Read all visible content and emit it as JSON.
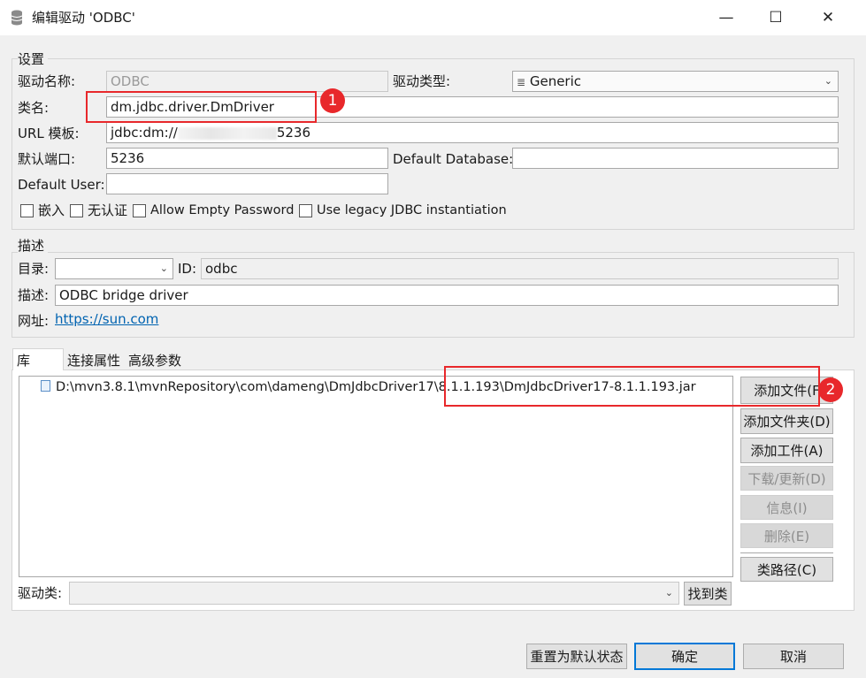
{
  "window": {
    "title": "编辑驱动 'ODBC'",
    "minimize": "—",
    "maximize": "☐",
    "close": "✕"
  },
  "settings": {
    "group_label": "设置",
    "driver_name_label": "驱动名称:",
    "driver_name_value": "ODBC",
    "driver_type_label": "驱动类型:",
    "driver_type_value": "Generic",
    "driver_type_icon": "≣",
    "class_name_label": "类名:",
    "class_name_value": "dm.jdbc.driver.DmDriver",
    "url_label": "URL 模板:",
    "url_value_prefix": "jdbc:dm://",
    "url_value_suffix": "5236",
    "port_label": "默认端口:",
    "port_value": "5236",
    "default_db_label": "Default Database:",
    "default_db_value": "",
    "default_user_label": "Default User:",
    "default_user_value": "",
    "checkboxes": [
      "嵌入",
      "无认证",
      "Allow Empty Password",
      "Use legacy JDBC instantiation"
    ]
  },
  "description": {
    "group_label": "描述",
    "catalog_label": "目录:",
    "catalog_value": "",
    "id_label": "ID:",
    "id_value": "odbc",
    "desc_label": "描述:",
    "desc_value": "ODBC bridge driver",
    "url_label": "网址:",
    "url_value": "https://sun.com"
  },
  "tabs": [
    "库",
    "连接属性",
    "高级参数"
  ],
  "library": {
    "file_path": "D:\\mvn3.8.1\\mvnRepository\\com\\dameng\\DmJdbcDriver17\\8.1.1.193\\DmJdbcDriver17-8.1.1.193.jar",
    "buttons": {
      "add_file": "添加文件(F",
      "add_folder": "添加文件夹(D)",
      "add_artifact": "添加工件(A)",
      "download": "下载/更新(D)",
      "info": "信息(I)",
      "delete": "删除(E)",
      "classpath": "类路径(C)"
    },
    "driver_class_label": "驱动类:",
    "driver_class_value": "",
    "find_class": "找到类"
  },
  "footer": {
    "reset": "重置为默认状态",
    "ok": "确定",
    "cancel": "取消"
  },
  "annotations": {
    "badge1": "1",
    "badge2": "2",
    "color": "#e8282b"
  }
}
